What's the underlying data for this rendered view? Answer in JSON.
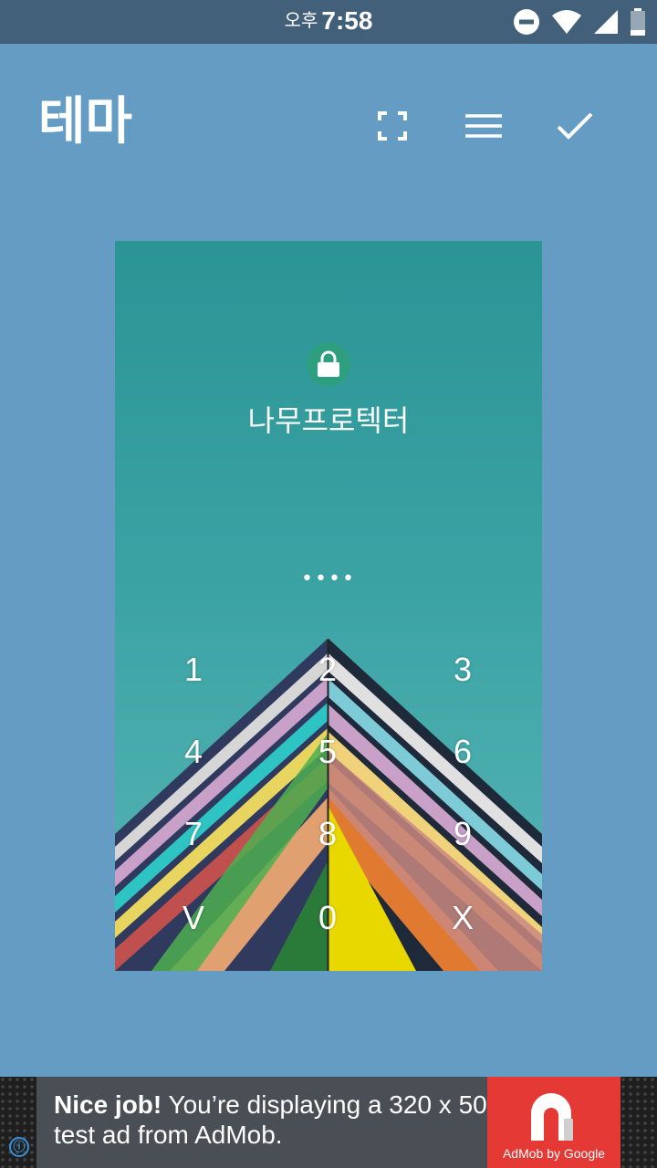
{
  "status_bar": {
    "ampm": "오후",
    "time": "7:58",
    "icons": [
      "do-not-disturb-icon",
      "wifi-icon",
      "cell-signal-icon",
      "battery-icon"
    ]
  },
  "app_bar": {
    "title": "테마",
    "actions": [
      "fullscreen-icon",
      "menu-icon",
      "check-icon"
    ]
  },
  "preview": {
    "app_name": "나무프로텍터",
    "pin_dots": "••••",
    "keypad": [
      "1",
      "2",
      "3",
      "4",
      "5",
      "6",
      "7",
      "8",
      "9",
      "V",
      "0",
      "X"
    ],
    "background_color": "#2b9495",
    "lock_icon": "lock-icon"
  },
  "ad": {
    "strong": "Nice job!",
    "text": " You’re displaying a 320 x 50 test ad from AdMob.",
    "brand": "AdMob by Google",
    "info_icon": "ⓘ"
  },
  "colors": {
    "background": "#659cc4",
    "status_bar": "#42607a",
    "ad_accent": "#e53935"
  }
}
